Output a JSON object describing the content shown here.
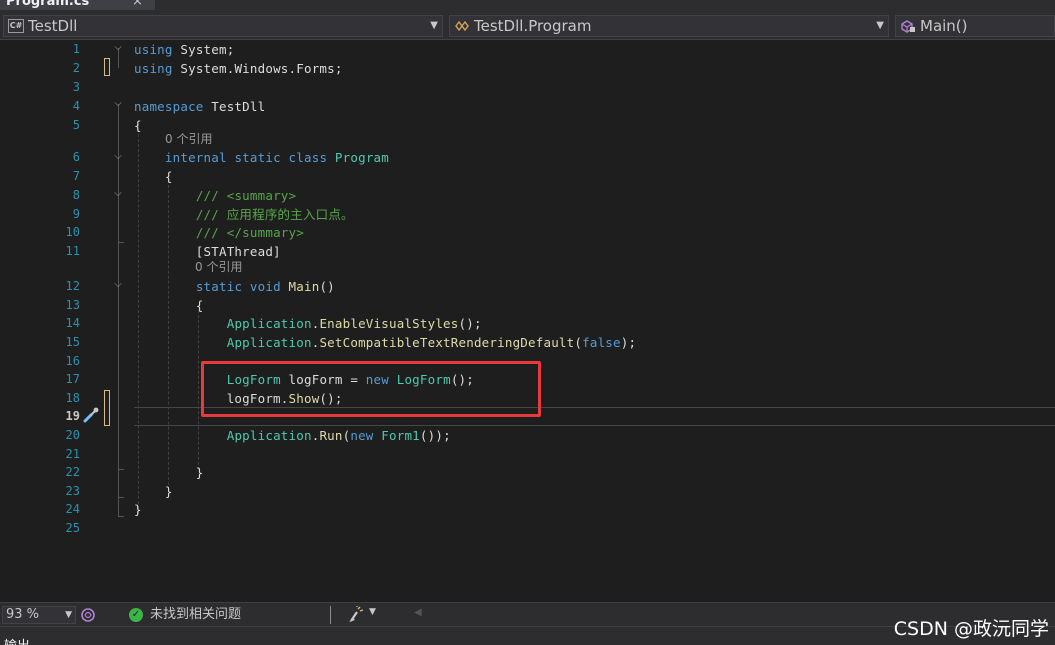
{
  "tab": {
    "title": "Program.cs",
    "close": "×"
  },
  "navbar": {
    "project": {
      "badge": "C#",
      "label": "TestDll"
    },
    "type": {
      "label": "TestDll.Program"
    },
    "member": {
      "label": "Main()"
    }
  },
  "lines": [
    {
      "n": "1",
      "tokens": [
        [
          "kw",
          "using"
        ],
        [
          "pl",
          " System;"
        ]
      ]
    },
    {
      "n": "2",
      "tokens": [
        [
          "kw",
          "using"
        ],
        [
          "pl",
          " System.Windows.Forms;"
        ]
      ]
    },
    {
      "n": "3",
      "tokens": []
    },
    {
      "n": "4",
      "tokens": [
        [
          "kw",
          "namespace"
        ],
        [
          "pl",
          " TestDll"
        ]
      ]
    },
    {
      "n": "5",
      "tokens": [
        [
          "pl",
          "{"
        ]
      ]
    },
    {
      "n": "6",
      "tokens": [
        [
          "pl",
          "    "
        ],
        [
          "kw",
          "internal"
        ],
        [
          "pl",
          " "
        ],
        [
          "kw",
          "static"
        ],
        [
          "pl",
          " "
        ],
        [
          "kw",
          "class"
        ],
        [
          "pl",
          " "
        ],
        [
          "ty",
          "Program"
        ]
      ]
    },
    {
      "n": "7",
      "tokens": [
        [
          "pl",
          "    {"
        ]
      ]
    },
    {
      "n": "8",
      "tokens": [
        [
          "pl",
          "        "
        ],
        [
          "cm",
          "/// <summary>"
        ]
      ]
    },
    {
      "n": "9",
      "tokens": [
        [
          "pl",
          "        "
        ],
        [
          "cm",
          "/// 应用程序的主入口点。"
        ]
      ]
    },
    {
      "n": "10",
      "tokens": [
        [
          "pl",
          "        "
        ],
        [
          "cm",
          "/// </summary>"
        ]
      ]
    },
    {
      "n": "11",
      "tokens": [
        [
          "pl",
          "        [STAThread]"
        ]
      ]
    },
    {
      "n": "12",
      "tokens": [
        [
          "pl",
          "        "
        ],
        [
          "kw",
          "static"
        ],
        [
          "pl",
          " "
        ],
        [
          "kw",
          "void"
        ],
        [
          "pl",
          " "
        ],
        [
          "fn",
          "Main"
        ],
        [
          "pl",
          "()"
        ]
      ]
    },
    {
      "n": "13",
      "tokens": [
        [
          "pl",
          "        {"
        ]
      ]
    },
    {
      "n": "14",
      "tokens": [
        [
          "pl",
          "            "
        ],
        [
          "ty",
          "Application"
        ],
        [
          "pl",
          "."
        ],
        [
          "fn",
          "EnableVisualStyles"
        ],
        [
          "pl",
          "();"
        ]
      ]
    },
    {
      "n": "15",
      "tokens": [
        [
          "pl",
          "            "
        ],
        [
          "ty",
          "Application"
        ],
        [
          "pl",
          "."
        ],
        [
          "fn",
          "SetCompatibleTextRenderingDefault"
        ],
        [
          "pl",
          "("
        ],
        [
          "kw",
          "false"
        ],
        [
          "pl",
          ");"
        ]
      ]
    },
    {
      "n": "16",
      "tokens": []
    },
    {
      "n": "17",
      "tokens": [
        [
          "pl",
          "            "
        ],
        [
          "ty",
          "LogForm"
        ],
        [
          "pl",
          " logForm = "
        ],
        [
          "kw",
          "new"
        ],
        [
          "pl",
          " "
        ],
        [
          "ty",
          "LogForm"
        ],
        [
          "pl",
          "();"
        ]
      ]
    },
    {
      "n": "18",
      "tokens": [
        [
          "pl",
          "            logForm."
        ],
        [
          "fn",
          "Show"
        ],
        [
          "pl",
          "();"
        ]
      ]
    },
    {
      "n": "19",
      "tokens": []
    },
    {
      "n": "20",
      "tokens": [
        [
          "pl",
          "            "
        ],
        [
          "ty",
          "Application"
        ],
        [
          "pl",
          "."
        ],
        [
          "fn",
          "Run"
        ],
        [
          "pl",
          "("
        ],
        [
          "kw",
          "new"
        ],
        [
          "pl",
          " "
        ],
        [
          "ty",
          "Form1"
        ],
        [
          "pl",
          "());"
        ]
      ]
    },
    {
      "n": "21",
      "tokens": []
    },
    {
      "n": "22",
      "tokens": [
        [
          "pl",
          "        }"
        ]
      ]
    },
    {
      "n": "23",
      "tokens": [
        [
          "pl",
          "    }"
        ]
      ]
    },
    {
      "n": "24",
      "tokens": [
        [
          "pl",
          "}"
        ]
      ]
    },
    {
      "n": "25",
      "tokens": []
    }
  ],
  "codelens": {
    "class_refs": "0 个引用",
    "method_refs": "0 个引用"
  },
  "status": {
    "zoom": "93 %",
    "issues": "未找到相关问题"
  },
  "output": {
    "label": "输出"
  },
  "watermark": "CSDN @政沅同学",
  "colors": {
    "keyword": "#569cd6",
    "type": "#4ec9b0",
    "method": "#dcdcaa",
    "comment": "#57a64a",
    "highlight_box": "#e8393d",
    "ok_icon": "#3bb54a"
  }
}
